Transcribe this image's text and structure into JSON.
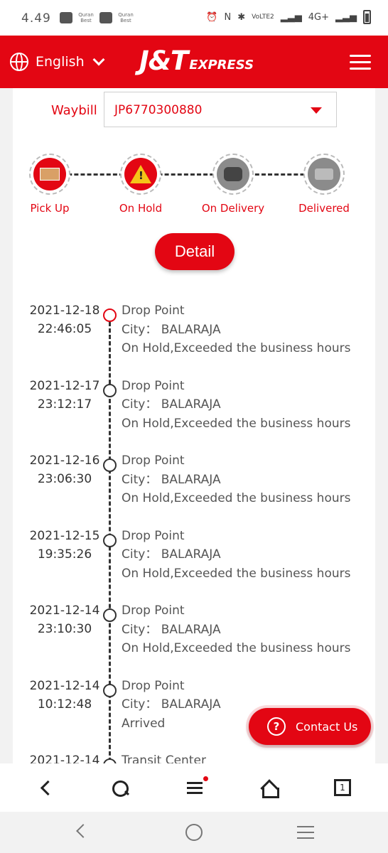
{
  "status_bar": {
    "time": "4.49",
    "network": "4G+",
    "volte": "VoLTE2"
  },
  "header": {
    "language": "English",
    "logo_main": "J&T",
    "logo_sub": "EXPRESS",
    "brand_color": "#e30613"
  },
  "waybill": {
    "label": "Waybill",
    "value": "JP6770300880"
  },
  "steps": [
    {
      "label": "Pick Up",
      "icon": "package-icon",
      "active": true
    },
    {
      "label": "On Hold",
      "icon": "warning-icon",
      "active": true
    },
    {
      "label": "On Delivery",
      "icon": "scooter-icon",
      "active": false
    },
    {
      "label": "Delivered",
      "icon": "hand-package-icon",
      "active": false
    }
  ],
  "detail_button": "Detail",
  "timeline": [
    {
      "date": "2021-12-18",
      "time": "22:46:05",
      "location": "Drop Point",
      "city": "City： BALARAJA",
      "status": "On Hold,Exceeded the business hours"
    },
    {
      "date": "2021-12-17",
      "time": "23:12:17",
      "location": "Drop Point",
      "city": "City： BALARAJA",
      "status": "On Hold,Exceeded the business hours"
    },
    {
      "date": "2021-12-16",
      "time": "23:06:30",
      "location": "Drop Point",
      "city": "City： BALARAJA",
      "status": "On Hold,Exceeded the business hours"
    },
    {
      "date": "2021-12-15",
      "time": "19:35:26",
      "location": "Drop Point",
      "city": "City： BALARAJA",
      "status": "On Hold,Exceeded the business hours"
    },
    {
      "date": "2021-12-14",
      "time": "23:10:30",
      "location": "Drop Point",
      "city": "City： BALARAJA",
      "status": "On Hold,Exceeded the business hours"
    },
    {
      "date": "2021-12-14",
      "time": "10:12:48",
      "location": "Drop Point",
      "city": "City： BALARAJA",
      "status": "Arrived"
    },
    {
      "date": "2021-12-14",
      "time": "",
      "location": "Transit Center",
      "city": "",
      "status": ""
    }
  ],
  "contact_button": "Contact Us",
  "browser_bar": {
    "tab_count": "1"
  }
}
